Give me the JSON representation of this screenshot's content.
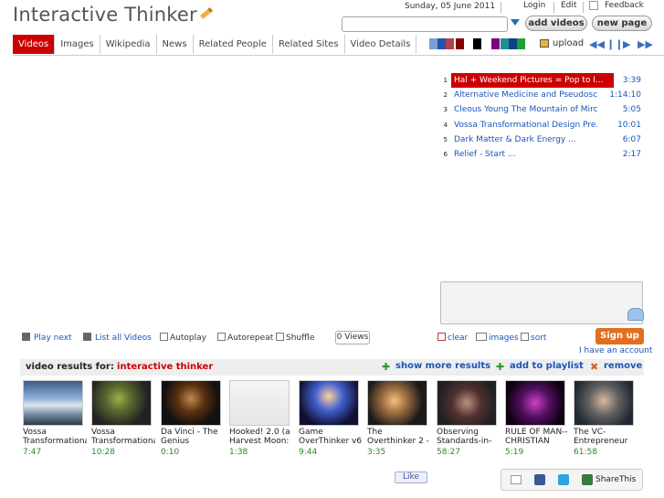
{
  "header": {
    "logo": "Interactive Thinker",
    "date": "Sunday, 05 June 2011",
    "links": [
      "Login",
      "Edit",
      "Feedback"
    ],
    "add_videos": "add videos",
    "new_page": "new page",
    "search_value": ""
  },
  "tabs": [
    {
      "label": "Videos",
      "active": true
    },
    {
      "label": "Images"
    },
    {
      "label": "Wikipedia"
    },
    {
      "label": "News"
    },
    {
      "label": "Related People"
    },
    {
      "label": "Related Sites"
    },
    {
      "label": "Video Details"
    }
  ],
  "toolbar": {
    "upload": "upload",
    "swatches": [
      "#7a9fd4",
      "#2255aa",
      "#b04050",
      "#8a0000",
      "#ffffff",
      "#000000",
      "#ffffff",
      "#800080",
      "#209090",
      "#10408a",
      "#20a030"
    ]
  },
  "playlist": [
    {
      "num": "1",
      "title": "Hal + Weekend Pictures = Pop to I...",
      "time": "3:39"
    },
    {
      "num": "2",
      "title": "Alternative Medicine and Pseudosc...",
      "time": "1:14:10"
    },
    {
      "num": "3",
      "title": "Cleous Young The Mountain of Mirc...",
      "time": "5:05"
    },
    {
      "num": "4",
      "title": "Vossa Transformational Design Pre...",
      "time": "10:01"
    },
    {
      "num": "5",
      "title": "Dark Matter & Dark Energy        ...",
      "time": "6:07"
    },
    {
      "num": "6",
      "title": "Relief - Start                    ...",
      "time": "2:17"
    }
  ],
  "controls": {
    "play_next": "Play next",
    "list_all": "List all Videos",
    "autoplay": "Autoplay",
    "autorepeat": "Autorepeat",
    "shuffle": "Shuffle",
    "views": "0 Views",
    "clear": "clear",
    "images": "images",
    "sort": "sort",
    "signup": "Sign up",
    "account": "I have an account"
  },
  "results": {
    "prefix": "video results for:",
    "query": "interactive thinker",
    "show_more": "show more results",
    "add_playlist": "add to playlist",
    "remove": "remove",
    "items": [
      {
        "title": "Vossa Transformationa",
        "dur": "7:47"
      },
      {
        "title": "Vossa Transformationa",
        "dur": "10:28"
      },
      {
        "title": "Da Vinci - The Genius",
        "dur": "0:10"
      },
      {
        "title": "Hooked! 2.0 (a Harvest Moon:",
        "dur": "1:38"
      },
      {
        "title": "Game OverThinker v6",
        "dur": "9:44"
      },
      {
        "title": "The Overthinker 2 -",
        "dur": "3:35"
      },
      {
        "title": "Observing Standards-in-",
        "dur": "58:27"
      },
      {
        "title": "RULE OF MAN-- CHRISTIAN",
        "dur": "5:19"
      },
      {
        "title": "The VC-Entrepreneur",
        "dur": "61:58"
      }
    ]
  },
  "social": {
    "like": "Like",
    "share": "ShareThis"
  }
}
